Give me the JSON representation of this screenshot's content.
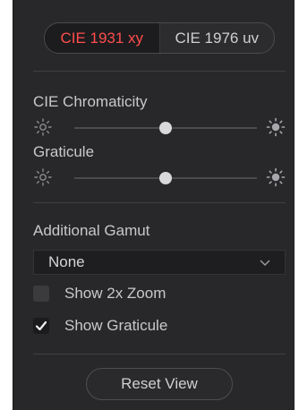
{
  "tabs": [
    {
      "label": "CIE 1931 xy",
      "active": true
    },
    {
      "label": "CIE 1976 uv",
      "active": false
    }
  ],
  "chromaticity": {
    "label": "CIE Chromaticity",
    "value_fraction": 0.5
  },
  "graticule": {
    "label": "Graticule",
    "value_fraction": 0.5
  },
  "gamut": {
    "label": "Additional Gamut",
    "selected": "None"
  },
  "options": {
    "zoom": {
      "label": "Show 2x Zoom",
      "checked": false
    },
    "graticule": {
      "label": "Show Graticule",
      "checked": true
    }
  },
  "reset_label": "Reset View",
  "colors": {
    "accent": "#ff4d4d",
    "panel": "#28282a"
  }
}
